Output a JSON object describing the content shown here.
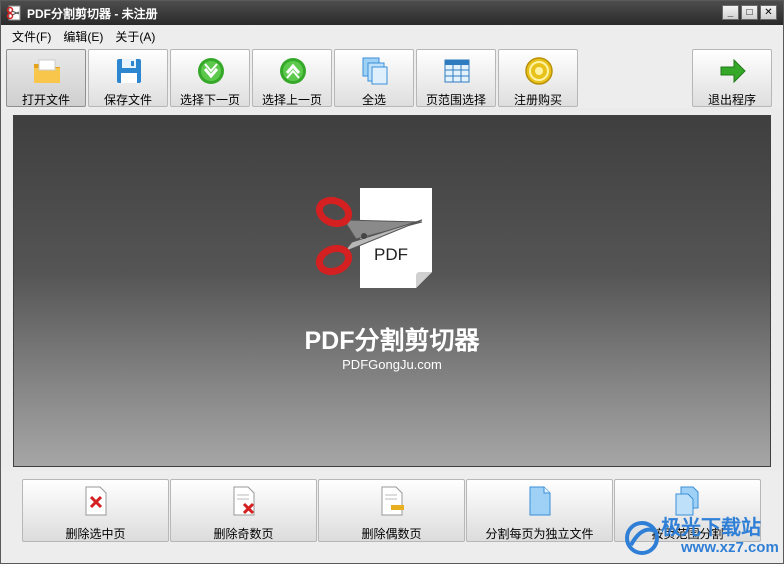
{
  "window": {
    "title": "PDF分割剪切器 - 未注册",
    "controls": {
      "minimize": "_",
      "maximize": "□",
      "close": "✕"
    }
  },
  "menu": [
    {
      "label": "文件(F)"
    },
    {
      "label": "编辑(E)"
    },
    {
      "label": "关于(A)"
    }
  ],
  "toolbar": [
    {
      "label": "打开文件",
      "icon": "folder-icon"
    },
    {
      "label": "保存文件",
      "icon": "floppy-icon"
    },
    {
      "label": "选择下一页",
      "icon": "arrow-down-circle-icon"
    },
    {
      "label": "选择上一页",
      "icon": "arrow-up-circle-icon"
    },
    {
      "label": "全选",
      "icon": "pages-stack-icon"
    },
    {
      "label": "页范围选择",
      "icon": "page-range-icon"
    },
    {
      "label": "注册购买",
      "icon": "coin-icon"
    },
    {
      "label": "退出程序",
      "icon": "exit-arrow-icon"
    }
  ],
  "main": {
    "app_name": "PDF分割剪切器",
    "site": "PDFGongJu.com",
    "logo_text": "PDF"
  },
  "bottom_buttons": [
    {
      "label": "删除选中页",
      "icon": "delete-page-icon"
    },
    {
      "label": "删除奇数页",
      "icon": "delete-odd-icon"
    },
    {
      "label": "删除偶数页",
      "icon": "delete-even-icon"
    },
    {
      "label": "分割每页为独立文件",
      "icon": "split-page-icon"
    },
    {
      "label": "按页范围分割",
      "icon": "split-range-icon"
    }
  ],
  "watermark": {
    "text": "极光下载站",
    "url": "www.xz7.com"
  },
  "colors": {
    "titlebar": "#2f2f2f",
    "panel_top": "#3f3f3f",
    "panel_bottom": "#a6a6a6",
    "scissors_red": "#d42020",
    "icon_green": "#35a82a",
    "icon_blue": "#3a8fd8",
    "coin_yellow": "#e8c21a"
  }
}
